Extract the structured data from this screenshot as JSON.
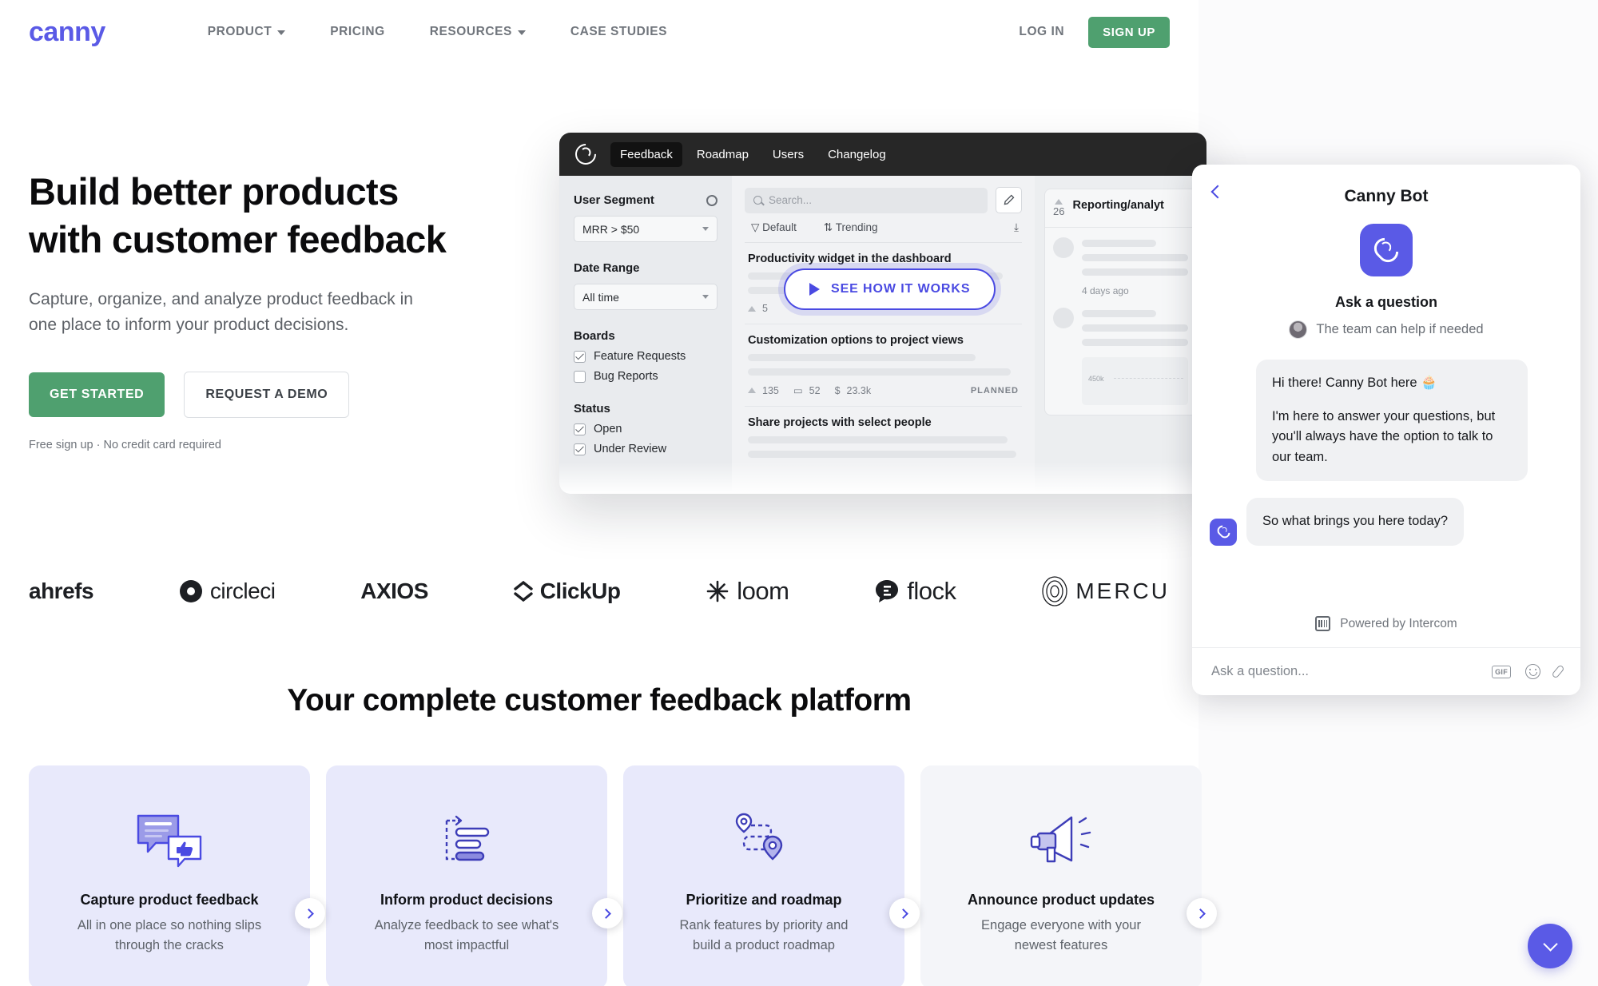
{
  "header": {
    "logo": "canny",
    "nav": [
      {
        "label": "PRODUCT",
        "has_caret": true
      },
      {
        "label": "PRICING",
        "has_caret": false
      },
      {
        "label": "RESOURCES",
        "has_caret": true
      },
      {
        "label": "CASE STUDIES",
        "has_caret": false
      }
    ],
    "login_label": "LOG IN",
    "signup_label": "SIGN UP",
    "accent_green": "#4fa06f",
    "brand_purple": "#5a5ae6"
  },
  "hero": {
    "title": "Build better products with customer feedback",
    "subtitle": "Capture, organize, and analyze product feedback in one place to inform your product decisions.",
    "primary_cta": "GET STARTED",
    "secondary_cta": "REQUEST A DEMO",
    "note": "Free sign up · No credit card required"
  },
  "mockup": {
    "tabs": [
      "Feedback",
      "Roadmap",
      "Users",
      "Changelog"
    ],
    "active_tab": "Feedback",
    "sidebar": {
      "user_segment_label": "User Segment",
      "user_segment_value": "MRR > $50",
      "date_range_label": "Date Range",
      "date_range_value": "All time",
      "boards_label": "Boards",
      "boards": [
        {
          "label": "Feature Requests",
          "checked": true
        },
        {
          "label": "Bug Reports",
          "checked": false
        }
      ],
      "status_label": "Status",
      "status": [
        {
          "label": "Open",
          "checked": true
        },
        {
          "label": "Under Review",
          "checked": true
        }
      ]
    },
    "search_placeholder": "Search...",
    "filter_default": "Default",
    "filter_sort": "Trending",
    "posts": [
      {
        "title": "Productivity widget in the dashboard",
        "votes": "5",
        "comments": "",
        "value": "",
        "status": ""
      },
      {
        "title": "Customization options to project views",
        "votes": "135",
        "comments": "52",
        "value": "23.3k",
        "status": "PLANNED"
      },
      {
        "title": "Share projects with select people",
        "votes": "",
        "comments": "",
        "value": "",
        "status": ""
      }
    ],
    "cta_label": "SEE HOW IT WORKS",
    "right_panel": {
      "votes": "26",
      "title": "Reporting/analyt",
      "timestamp": "4 days ago",
      "chart_label": "450k"
    }
  },
  "logos": [
    "ahrefs",
    "circleci",
    "AXIOS",
    "ClickUp",
    "loom",
    "flock",
    "MERCU"
  ],
  "section2": {
    "title": "Your complete customer feedback platform",
    "cards": [
      {
        "icon": "speech-bubble-thumbsup-icon",
        "title": "Capture product feedback",
        "desc": "All in one place so nothing slips through the cracks"
      },
      {
        "icon": "bar-list-icon",
        "title": "Inform product decisions",
        "desc": "Analyze feedback to see what's most impactful"
      },
      {
        "icon": "roadmap-pins-icon",
        "title": "Prioritize and roadmap",
        "desc": "Rank features by priority and build a product roadmap"
      },
      {
        "icon": "megaphone-icon",
        "title": "Announce product updates",
        "desc": "Engage everyone with your newest features"
      }
    ]
  },
  "chat": {
    "title": "Canny Bot",
    "heading": "Ask a question",
    "subheading": "The team can help if needed",
    "messages": [
      {
        "lines": [
          "Hi there! Canny Bot here 🧁",
          "I'm here to answer your questions, but you'll always have the option to talk to our team."
        ],
        "with_avatar": false
      },
      {
        "lines": [
          "So what brings you here today?"
        ],
        "with_avatar": true
      }
    ],
    "powered_by": "Powered by Intercom",
    "input_placeholder": "Ask a question...",
    "gif_label": "GIF"
  }
}
